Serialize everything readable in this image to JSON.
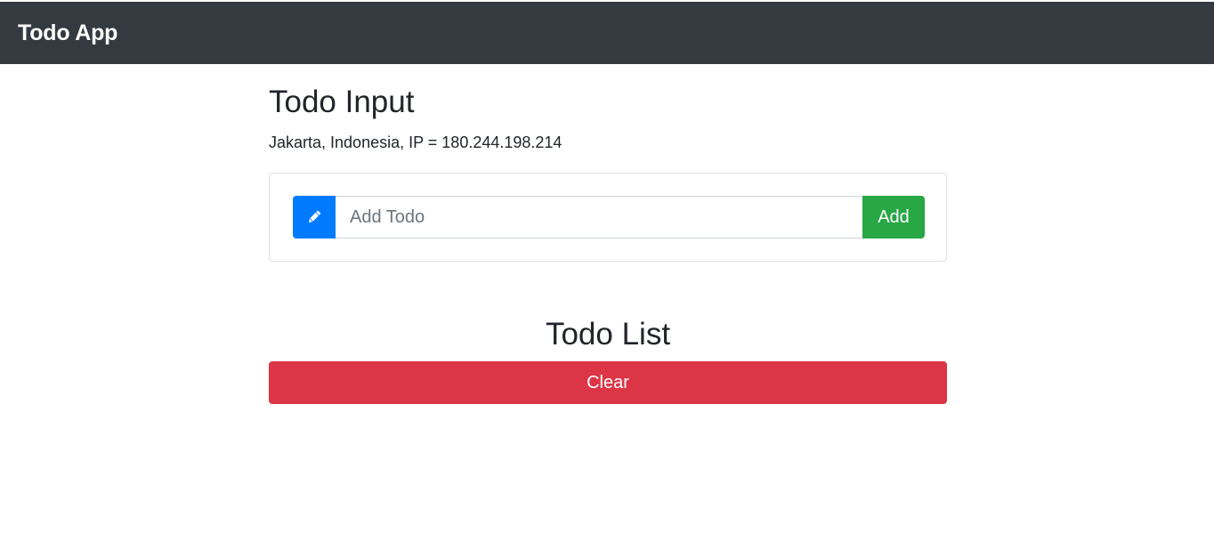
{
  "navbar": {
    "brand": "Todo App",
    "background": "#343a40"
  },
  "input_section": {
    "title": "Todo Input",
    "location_text": "Jakarta, Indonesia, IP = 180.244.198.214",
    "icon": "pencil-icon",
    "input_placeholder": "Add Todo",
    "input_value": "",
    "add_label": "Add"
  },
  "list_section": {
    "title": "Todo List",
    "clear_label": "Clear",
    "items": []
  },
  "colors": {
    "primary": "#007bff",
    "success": "#28a745",
    "danger": "#dc3545"
  }
}
